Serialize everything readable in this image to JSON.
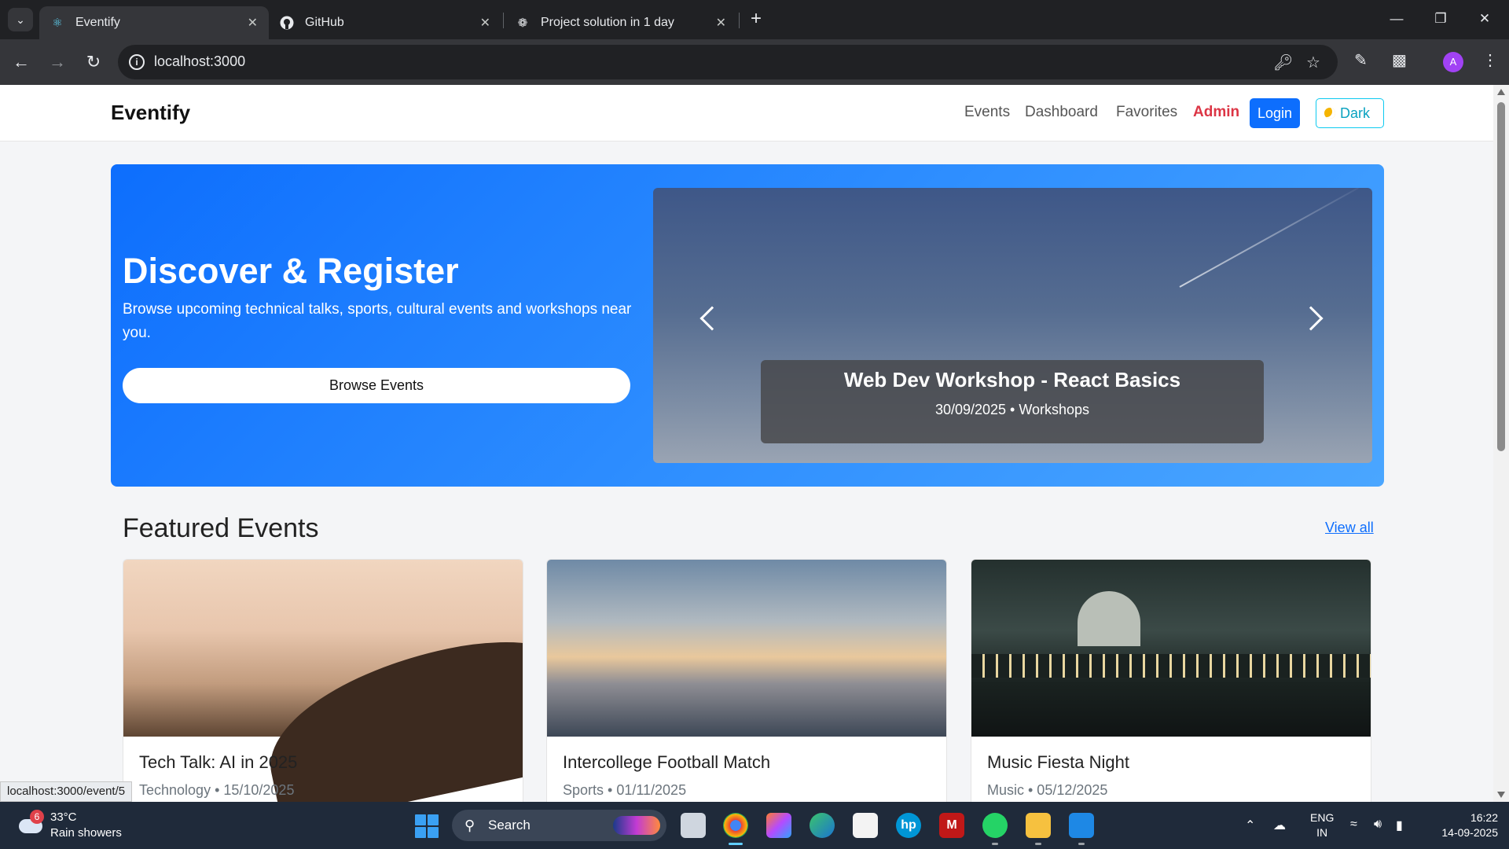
{
  "browser": {
    "tabs": [
      {
        "label": "Eventify",
        "icon": "react-icon",
        "active": true
      },
      {
        "label": "GitHub",
        "icon": "github-icon",
        "active": false
      },
      {
        "label": "Project solution in 1 day",
        "icon": "chatgpt-icon",
        "active": false
      }
    ],
    "url": "localhost:3000",
    "status_url": "localhost:3000/event/5",
    "profile_initial": "A"
  },
  "navbar": {
    "brand": "Eventify",
    "links": [
      "Events",
      "Dashboard",
      "Favorites",
      "Admin"
    ],
    "login_label": "Login",
    "theme_label": "Dark"
  },
  "hero": {
    "title": "Discover & Register",
    "subtitle": "Browse upcoming technical talks, sports, cultural events and workshops near you.",
    "cta_label": "Browse Events",
    "slide": {
      "title": "Web Dev Workshop - React Basics",
      "meta": "30/09/2025 • Workshops"
    }
  },
  "featured": {
    "heading": "Featured Events",
    "view_all": "View all",
    "cards": [
      {
        "title": "Tech Talk: AI in 2025",
        "meta": "Technology • 15/10/2025"
      },
      {
        "title": "Intercollege Football Match",
        "meta": "Sports • 01/11/2025"
      },
      {
        "title": "Music Fiesta Night",
        "meta": "Music • 05/12/2025"
      }
    ]
  },
  "taskbar": {
    "weather_temp": "33°C",
    "weather_desc": "Rain showers",
    "weather_badge": "6",
    "search_label": "Search",
    "lang_line1": "ENG",
    "lang_line2": "IN",
    "time": "16:22",
    "date": "14-09-2025"
  },
  "colors": {
    "primary": "#0d6efd",
    "admin": "#dc3545",
    "tabbar_bg": "#202124",
    "taskbar_bg": "#1f2a3a"
  }
}
